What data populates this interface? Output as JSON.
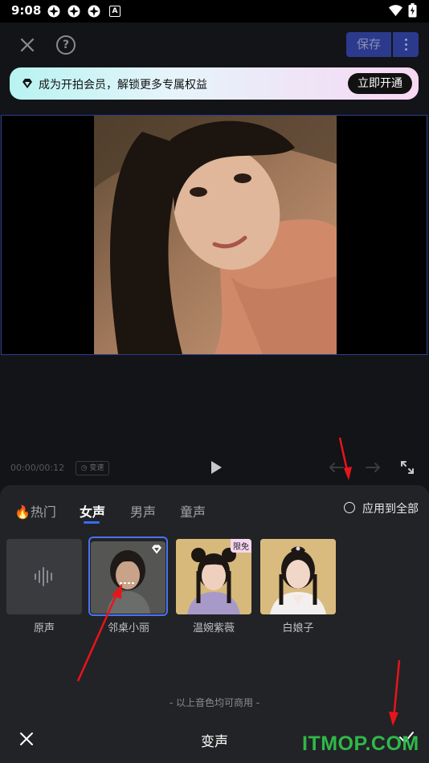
{
  "status_bar": {
    "time": "9:08",
    "badge_letter": "A"
  },
  "toolbar": {
    "save_label": "保存",
    "help_symbol": "?"
  },
  "member_banner": {
    "text": "成为开拍会员，解锁更多专属权益",
    "button_label": "立即开通"
  },
  "playback": {
    "time": "00:00/00:12",
    "speed_label": "变速"
  },
  "tabs": [
    {
      "label": "🔥热门",
      "active": false
    },
    {
      "label": "女声",
      "active": true
    },
    {
      "label": "男声",
      "active": false
    },
    {
      "label": "童声",
      "active": false
    }
  ],
  "apply_all_label": "应用到全部",
  "voices": [
    {
      "label": "原声",
      "selected": false,
      "badge": ""
    },
    {
      "label": "邻桌小丽",
      "selected": true,
      "badge": "vip"
    },
    {
      "label": "温婉紫薇",
      "selected": false,
      "badge": "限免"
    },
    {
      "label": "白娘子",
      "selected": false,
      "badge": ""
    }
  ],
  "footer_note": "- 以上音色均可商用 -",
  "panel_title": "变声",
  "watermark": "ITMOP.COM",
  "colors": {
    "accent": "#3a6bf5",
    "save_button": "#2b3a8c",
    "annotation_arrow": "#e8141b"
  }
}
